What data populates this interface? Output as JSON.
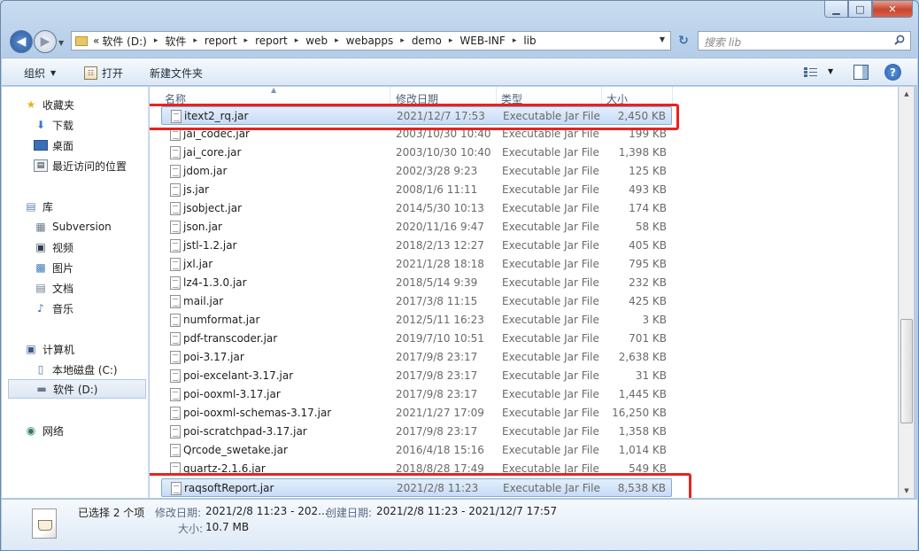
{
  "window": {
    "controls": {
      "minimize": "▁",
      "maximize": "□",
      "close": "✕"
    }
  },
  "address": {
    "overflow": "«",
    "segments": [
      "软件 (D:)",
      "软件",
      "report",
      "report",
      "web",
      "webapps",
      "demo",
      "WEB-INF",
      "lib"
    ],
    "separator": "▸",
    "search_placeholder": "搜索 lib"
  },
  "toolbar": {
    "organize": "组织",
    "open": "打开",
    "new_folder": "新建文件夹"
  },
  "sidebar": {
    "favorites_title": "收藏夹",
    "favorites": [
      "下载",
      "桌面",
      "最近访问的位置"
    ],
    "library_title": "库",
    "library": [
      "Subversion",
      "视频",
      "图片",
      "文档",
      "音乐"
    ],
    "computer_title": "计算机",
    "drives": [
      "本地磁盘 (C:)",
      "软件 (D:)"
    ],
    "network_title": "网络"
  },
  "columns": {
    "name": "名称",
    "date": "修改日期",
    "type": "类型",
    "size": "大小"
  },
  "files": [
    {
      "name": "itext2_rq.jar",
      "date": "2021/12/7 17:53",
      "type": "Executable Jar File",
      "size": "2,450 KB",
      "selected": true
    },
    {
      "name": "jai_codec.jar",
      "date": "2003/10/30 10:40",
      "type": "Executable Jar File",
      "size": "199 KB"
    },
    {
      "name": "jai_core.jar",
      "date": "2003/10/30 10:40",
      "type": "Executable Jar File",
      "size": "1,398 KB"
    },
    {
      "name": "jdom.jar",
      "date": "2002/3/28 9:23",
      "type": "Executable Jar File",
      "size": "125 KB"
    },
    {
      "name": "js.jar",
      "date": "2008/1/6 11:11",
      "type": "Executable Jar File",
      "size": "493 KB"
    },
    {
      "name": "jsobject.jar",
      "date": "2014/5/30 10:13",
      "type": "Executable Jar File",
      "size": "174 KB"
    },
    {
      "name": "json.jar",
      "date": "2020/11/16 9:47",
      "type": "Executable Jar File",
      "size": "58 KB"
    },
    {
      "name": "jstl-1.2.jar",
      "date": "2018/2/13 12:27",
      "type": "Executable Jar File",
      "size": "405 KB"
    },
    {
      "name": "jxl.jar",
      "date": "2021/1/28 18:18",
      "type": "Executable Jar File",
      "size": "795 KB"
    },
    {
      "name": "lz4-1.3.0.jar",
      "date": "2018/5/14 9:39",
      "type": "Executable Jar File",
      "size": "232 KB"
    },
    {
      "name": "mail.jar",
      "date": "2017/3/8 11:15",
      "type": "Executable Jar File",
      "size": "425 KB"
    },
    {
      "name": "numformat.jar",
      "date": "2012/5/11 16:23",
      "type": "Executable Jar File",
      "size": "3 KB"
    },
    {
      "name": "pdf-transcoder.jar",
      "date": "2019/7/10 10:51",
      "type": "Executable Jar File",
      "size": "701 KB"
    },
    {
      "name": "poi-3.17.jar",
      "date": "2017/9/8 23:17",
      "type": "Executable Jar File",
      "size": "2,638 KB"
    },
    {
      "name": "poi-excelant-3.17.jar",
      "date": "2017/9/8 23:17",
      "type": "Executable Jar File",
      "size": "31 KB"
    },
    {
      "name": "poi-ooxml-3.17.jar",
      "date": "2017/9/8 23:17",
      "type": "Executable Jar File",
      "size": "1,445 KB"
    },
    {
      "name": "poi-ooxml-schemas-3.17.jar",
      "date": "2021/1/27 17:09",
      "type": "Executable Jar File",
      "size": "16,250 KB"
    },
    {
      "name": "poi-scratchpad-3.17.jar",
      "date": "2017/9/8 23:17",
      "type": "Executable Jar File",
      "size": "1,358 KB"
    },
    {
      "name": "Qrcode_swetake.jar",
      "date": "2016/4/18 15:16",
      "type": "Executable Jar File",
      "size": "1,014 KB"
    },
    {
      "name": "quartz-2.1.6.jar",
      "date": "2018/8/28 17:49",
      "type": "Executable Jar File",
      "size": "549 KB"
    },
    {
      "name": "raqsoftReport.jar",
      "date": "2021/2/8 11:23",
      "type": "Executable Jar File",
      "size": "8,538 KB",
      "selected": true
    }
  ],
  "details": {
    "selected_count": "已选择 2 个项",
    "modified_label": "修改日期:",
    "modified_value": "2021/2/8 11:23 - 202...",
    "created_label": "创建日期:",
    "created_value": "2021/2/8 11:23 - 2021/12/7 17:57",
    "size_label": "大小:",
    "size_value": "10.7 MB"
  },
  "colors": {
    "highlight_box": "#e8231f",
    "selection": "#c7dcf6"
  }
}
